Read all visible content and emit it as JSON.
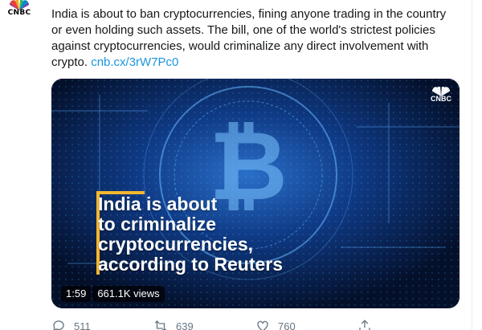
{
  "account": {
    "avatar_label": "CNBC"
  },
  "tweet": {
    "text": "India is about to ban cryptocurrencies, fining anyone trading in the country or even holding such assets. The bill, one of the world's strictest policies against cryptocurrencies, would criminalize any direct involvement with crypto. ",
    "link": "cnb.cx/3rW7Pc0"
  },
  "media": {
    "headline_lines": [
      "India is about",
      "to criminalize",
      "cryptocurrencies,",
      "according to Reuters"
    ],
    "logo_label": "CNBC",
    "duration": "1:59",
    "views": "661.1K views",
    "accent_color": "#f5b72f"
  },
  "actions": {
    "reply_count": "511",
    "retweet_count": "639",
    "like_count": "760"
  }
}
